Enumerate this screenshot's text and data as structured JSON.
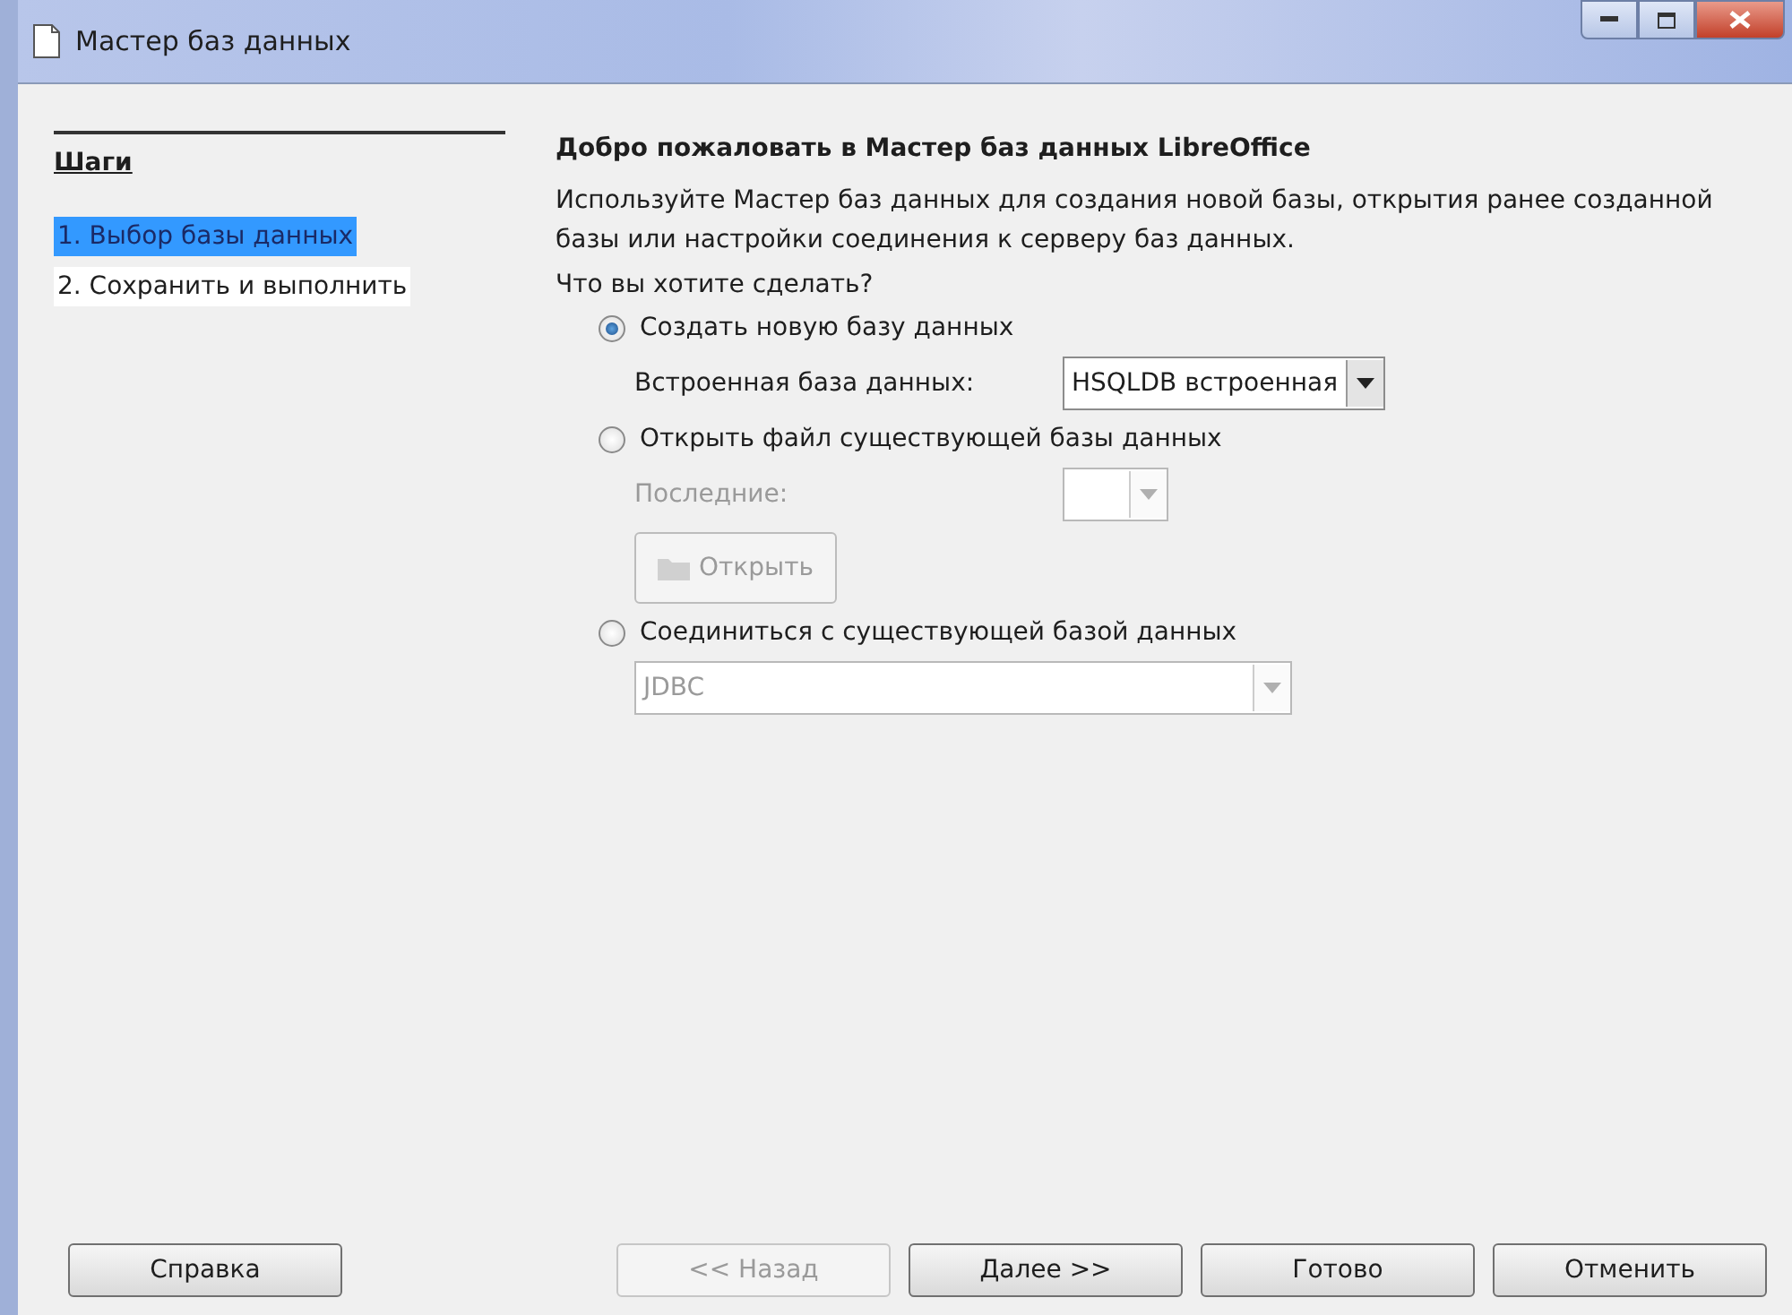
{
  "window": {
    "title": "Мастер баз данных"
  },
  "sidebar": {
    "heading": "Шаги",
    "items": [
      {
        "label": "1. Выбор базы данных",
        "selected": true
      },
      {
        "label": "2. Сохранить и выполнить",
        "selected": false
      }
    ]
  },
  "content": {
    "title": "Добро пожаловать в Мастер баз данных LibreOffice",
    "description": "Используйте Мастер баз данных для создания новой базы, открытия ранее созданной базы или настройки соединения к серверу баз данных.",
    "question": "Что вы хотите сделать?",
    "options": [
      {
        "label": "Создать новую базу данных",
        "selected": true,
        "fields": [
          {
            "kind": "combo",
            "label": "Встроенная база данных:",
            "value": "HSQLDB встроенная",
            "disabled": false
          }
        ]
      },
      {
        "label": "Открыть файл существующей базы данных",
        "selected": false,
        "fields": [
          {
            "kind": "combo-small",
            "label": "Последние:",
            "disabled": true
          },
          {
            "kind": "button",
            "label": "Открыть",
            "disabled": true
          }
        ]
      },
      {
        "label": "Соединиться с существующей базой данных",
        "selected": false,
        "fields": [
          {
            "kind": "combo-wide",
            "value": "JDBC",
            "disabled": true
          }
        ]
      }
    ]
  },
  "help_button": {
    "label": "Справка",
    "disabled": false
  },
  "buttons": [
    {
      "label": "<< Назад",
      "disabled": true
    },
    {
      "label": "Далее >>",
      "disabled": false
    },
    {
      "label": "Готово",
      "disabled": false
    },
    {
      "label": "Отменить",
      "disabled": false
    }
  ]
}
